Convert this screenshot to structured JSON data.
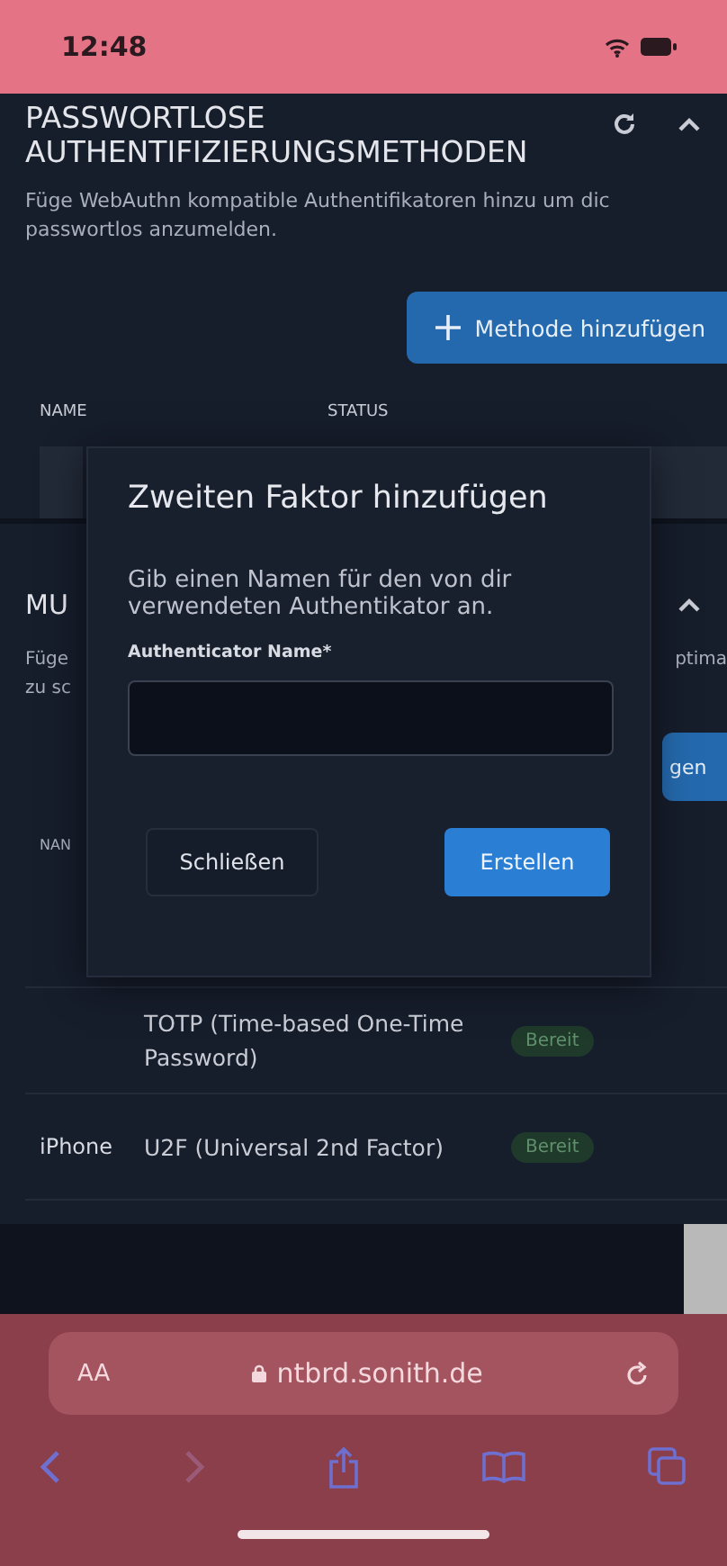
{
  "status_bar": {
    "time": "12:48"
  },
  "section_passwordless": {
    "title_lines": [
      "PASSWORTLOSE",
      "AUTHENTIFIZIERUNGSMETHODEN"
    ],
    "expanded": true,
    "description_lines": [
      "Füge WebAuthn kompatible Authentifikatoren hinzu um dic",
      "passwortlos anzumelden."
    ],
    "add_button": "Methode hinzufügen",
    "columns": [
      "NAME",
      "STATUS"
    ]
  },
  "section_mfa_fragments": {
    "title": "MU",
    "expanded": true,
    "description_left": [
      "Füge",
      "zu sc"
    ],
    "description_right": "ptima",
    "button_fragment": "gen",
    "column_fragment": "NAN"
  },
  "mfa_rows": [
    {
      "name": "",
      "type": "TOTP (Time-based One-Time Password)",
      "status": "Bereit"
    },
    {
      "name": "iPhone",
      "type": "U2F (Universal 2nd Factor)",
      "status": "Bereit"
    }
  ],
  "dialog": {
    "title": "Zweiten Faktor hinzufügen",
    "text": "Gib einen Namen für den von dir verwendeten Authentikator an.",
    "field_label": "Authenticator Name*",
    "buttons": [
      {
        "label": "Schließen",
        "kind": "secondary"
      },
      {
        "label": "Erstellen",
        "kind": "primary"
      }
    ]
  },
  "browser": {
    "text_size": "AA",
    "url": "ntbrd.sonith.de",
    "toolbar": [
      {
        "kind": "back",
        "disabled": false
      },
      {
        "kind": "forward",
        "disabled": true
      },
      {
        "kind": "share",
        "disabled": false
      },
      {
        "kind": "bookmarks",
        "disabled": false
      },
      {
        "kind": "tabs",
        "disabled": false
      }
    ]
  }
}
